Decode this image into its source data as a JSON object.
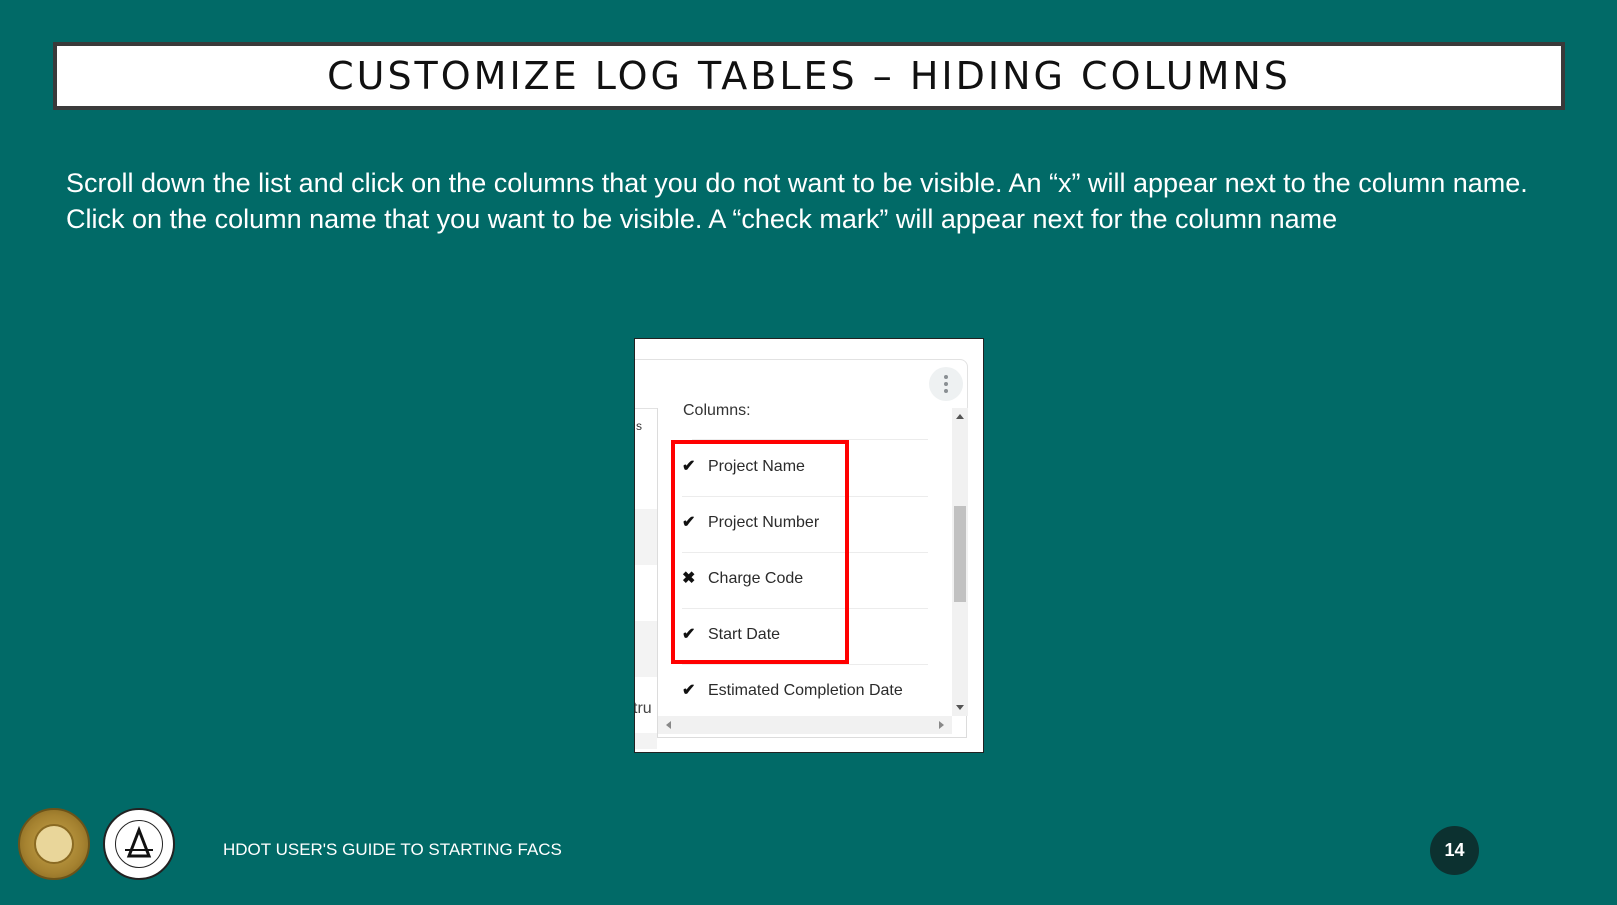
{
  "slide": {
    "title": "CUSTOMIZE LOG TABLES – HIDING COLUMNS",
    "paragraphs": [
      "Scroll down the list and click on the columns that you do not want to be visible.  An “x” will appear next to the column name.",
      "Click on the column name that you want to be visible.  A “check mark” will appear next for the column name"
    ]
  },
  "screenshot": {
    "dropdown_header": "Columns:",
    "items": [
      {
        "label": "Project Name",
        "mark": "✔",
        "mark_icon": "check-icon"
      },
      {
        "label": "Project Number",
        "mark": "✔",
        "mark_icon": "check-icon"
      },
      {
        "label": "Charge Code",
        "mark": "✖",
        "mark_icon": "x-icon"
      },
      {
        "label": "Start Date",
        "mark": "✔",
        "mark_icon": "check-icon"
      },
      {
        "label": "Estimated Completion Date",
        "mark": "✔",
        "mark_icon": "check-icon"
      }
    ],
    "left_cut_text_top": "s",
    "left_cut_text_bottom": "tru",
    "highlight_color": "#ff0000"
  },
  "footer": {
    "text": "HDOT USER'S GUIDE TO STARTING FACS",
    "page_number": "14"
  },
  "colors": {
    "background": "#016a67",
    "title_box": "#ffffff",
    "page_badge": "#0c3130"
  }
}
